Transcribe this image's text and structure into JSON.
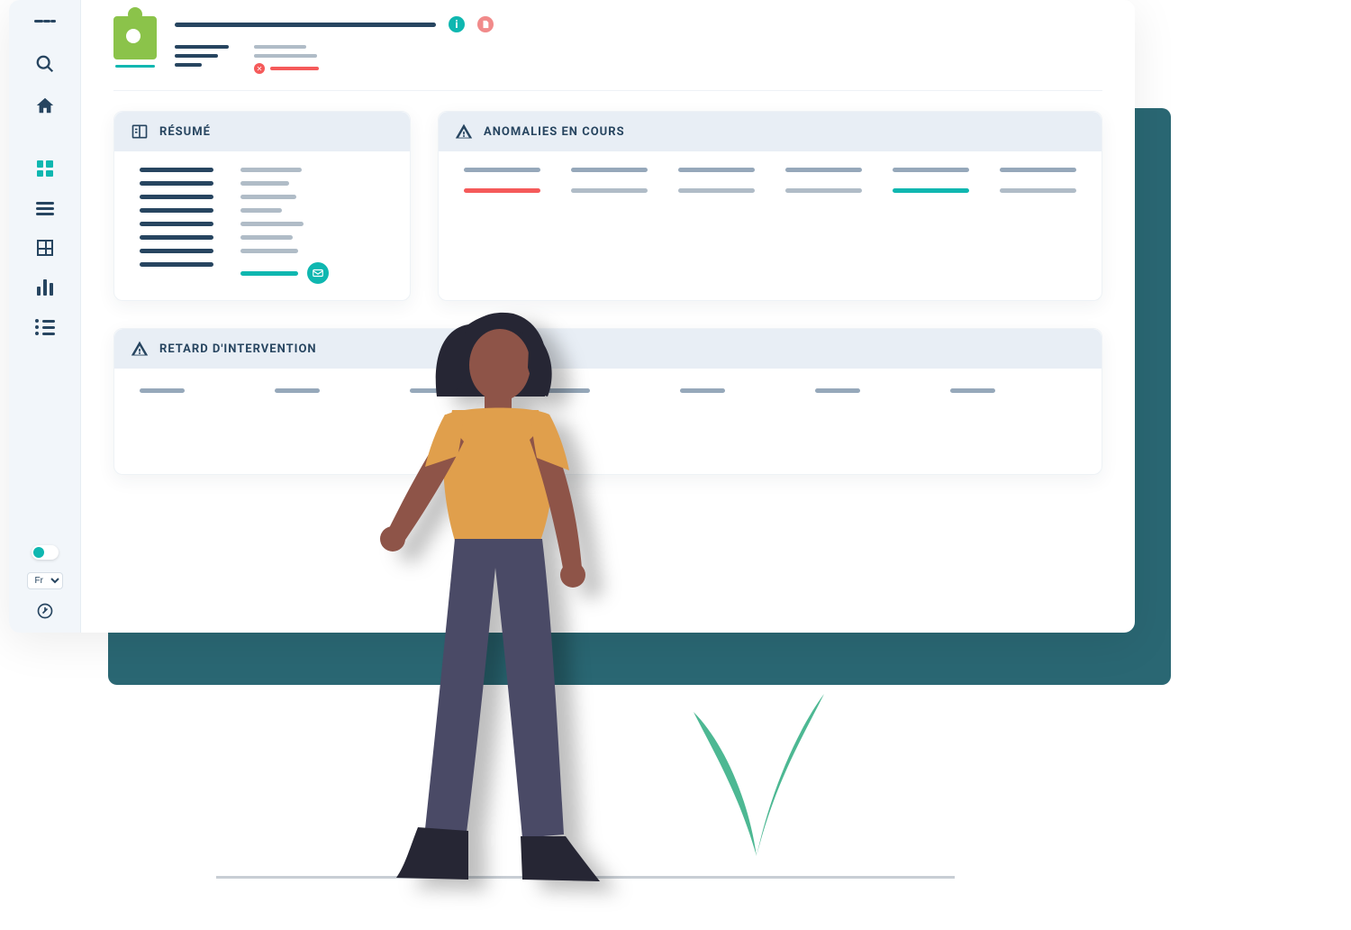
{
  "sidebar": {
    "lang": "Fr",
    "items": {
      "search": "search",
      "home": "home",
      "dashboard": "dashboard",
      "list": "list",
      "table": "table",
      "chart": "chart",
      "bullets": "bullets"
    }
  },
  "header": {
    "info_glyph": "i"
  },
  "panels": {
    "resume": {
      "title": "RÉSUMÉ"
    },
    "anomalies": {
      "title": "ANOMALIES EN COURS"
    },
    "retard": {
      "title": "RETARD D'INTERVENTION"
    }
  },
  "colors": {
    "primary": "#274560",
    "accent": "#0fb7b0",
    "danger": "#f55a5a",
    "muted": "#b0bcc7",
    "green": "#8bc34a"
  }
}
